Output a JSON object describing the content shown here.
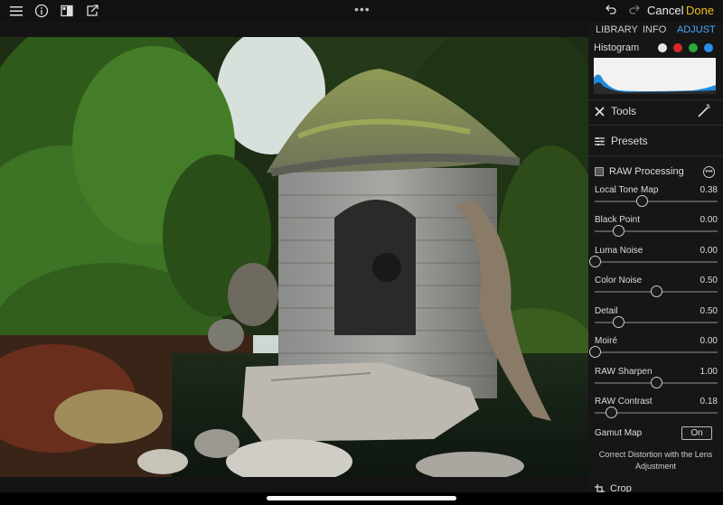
{
  "topbar": {
    "menu_icon": "hamburger-icon",
    "info_icon": "info-icon",
    "compare_icon": "compare-icon",
    "export_icon": "export-icon",
    "more_dots": "•••",
    "undo_icon": "undo-icon",
    "redo_icon": "redo-icon",
    "cancel_label": "Cancel",
    "done_label": "Done",
    "done_color": "#e6c21a"
  },
  "panel": {
    "tabs": [
      {
        "label": "LIBRARY",
        "active": false
      },
      {
        "label": "INFO",
        "active": false
      },
      {
        "label": "ADJUST",
        "active": true
      }
    ],
    "histogram": {
      "title": "Histogram",
      "channels": [
        {
          "name": "all",
          "color": "#e6e6e6"
        },
        {
          "name": "red",
          "color": "#d62a2a"
        },
        {
          "name": "green",
          "color": "#2aa83a"
        },
        {
          "name": "blue",
          "color": "#2a8ee6"
        }
      ]
    },
    "tools_label": "Tools",
    "presets_label": "Presets",
    "raw_processing": {
      "title": "RAW Processing",
      "sliders": [
        {
          "label": "Local Tone Map",
          "value": "0.38",
          "fraction": 0.38
        },
        {
          "label": "Black Point",
          "value": "0.00",
          "fraction": 0.19
        },
        {
          "label": "Luma Noise",
          "value": "0.00",
          "fraction": 0.0
        },
        {
          "label": "Color Noise",
          "value": "0.50",
          "fraction": 0.5
        },
        {
          "label": "Detail",
          "value": "0.50",
          "fraction": 0.19
        },
        {
          "label": "Moiré",
          "value": "0.00",
          "fraction": 0.0
        },
        {
          "label": "RAW Sharpen",
          "value": "1.00",
          "fraction": 0.5
        },
        {
          "label": "RAW Contrast",
          "value": "0.18",
          "fraction": 0.13
        }
      ],
      "gamut_map_label": "Gamut Map",
      "gamut_map_value": "On",
      "correct_distortion_text": "Correct Distortion with the Lens Adjustment"
    },
    "crop_label": "Crop"
  }
}
